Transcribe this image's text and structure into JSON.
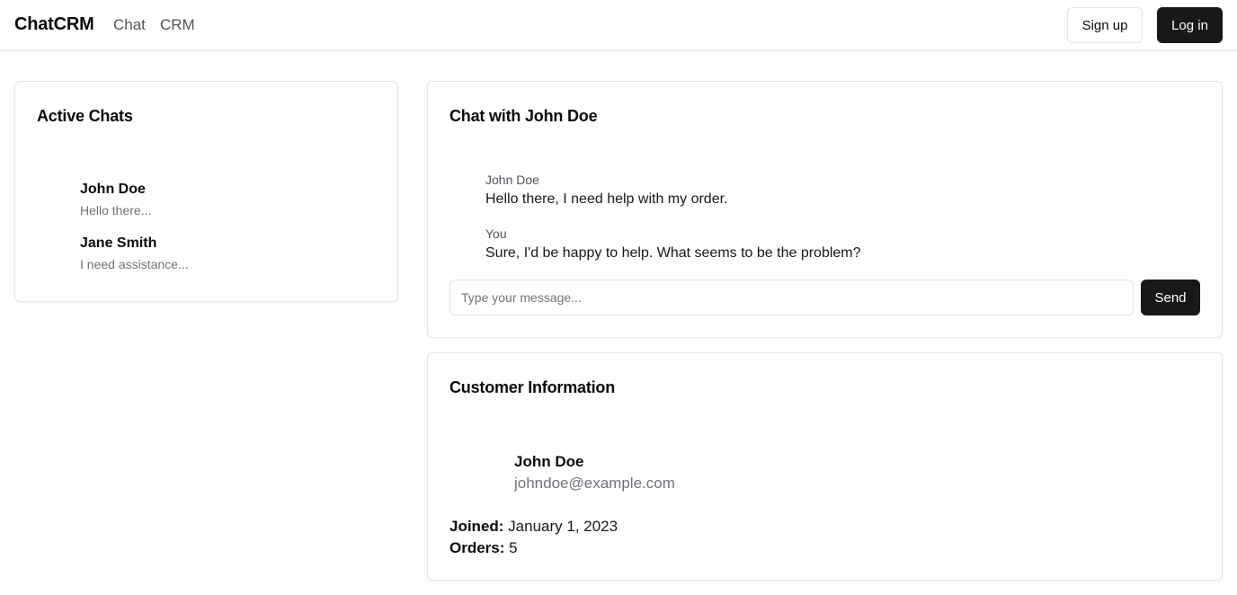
{
  "header": {
    "brand": "ChatCRM",
    "nav": {
      "chat": "Chat",
      "crm": "CRM"
    },
    "signup_label": "Sign up",
    "login_label": "Log in"
  },
  "active_chats": {
    "title": "Active Chats",
    "items": [
      {
        "name": "John Doe",
        "preview": "Hello there..."
      },
      {
        "name": "Jane Smith",
        "preview": "I need assistance..."
      }
    ]
  },
  "conversation": {
    "title": "Chat with John Doe",
    "messages": [
      {
        "sender": "John Doe",
        "text": "Hello there, I need help with my order."
      },
      {
        "sender": "You",
        "text": "Sure, I'd be happy to help. What seems to be the problem?"
      }
    ],
    "input_placeholder": "Type your message...",
    "input_value": "",
    "send_label": "Send"
  },
  "customer": {
    "title": "Customer Information",
    "name": "John Doe",
    "email": "johndoe@example.com",
    "joined_label": "Joined:",
    "joined_value": "January 1, 2023",
    "orders_label": "Orders:",
    "orders_value": "5"
  },
  "colors": {
    "primary_button": "#18181b",
    "border": "#e4e4e7",
    "muted_text": "#71717a"
  }
}
